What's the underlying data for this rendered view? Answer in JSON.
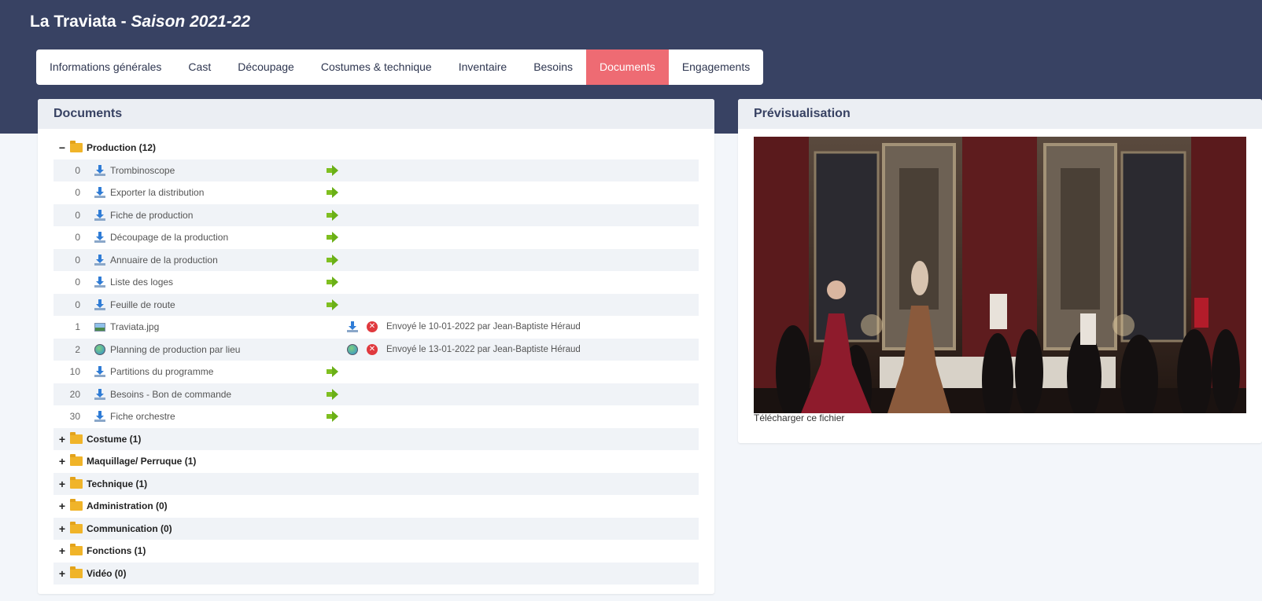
{
  "header": {
    "title": "La Traviata",
    "separator": " - ",
    "season": "Saison 2021-22"
  },
  "tabs": [
    {
      "label": "Informations générales",
      "active": false
    },
    {
      "label": "Cast",
      "active": false
    },
    {
      "label": "Découpage",
      "active": false
    },
    {
      "label": "Costumes & technique",
      "active": false
    },
    {
      "label": "Inventaire",
      "active": false
    },
    {
      "label": "Besoins",
      "active": false
    },
    {
      "label": "Documents",
      "active": true
    },
    {
      "label": "Engagements",
      "active": false
    }
  ],
  "documents_panel": {
    "title": "Documents",
    "production_folder": {
      "label": "Production (12)",
      "toggle": "−",
      "items": [
        {
          "num": "0",
          "label": "Trombinoscope",
          "icon": "download-icon",
          "action": "arrow"
        },
        {
          "num": "0",
          "label": "Exporter la distribution",
          "icon": "download-icon",
          "action": "arrow"
        },
        {
          "num": "0",
          "label": "Fiche de production",
          "icon": "download-icon",
          "action": "arrow"
        },
        {
          "num": "0",
          "label": "Découpage de la production",
          "icon": "download-icon",
          "action": "arrow"
        },
        {
          "num": "0",
          "label": "Annuaire de la production",
          "icon": "download-icon",
          "action": "arrow"
        },
        {
          "num": "0",
          "label": "Liste des loges",
          "icon": "download-icon",
          "action": "arrow"
        },
        {
          "num": "0",
          "label": "Feuille de route",
          "icon": "download-icon",
          "action": "arrow"
        },
        {
          "num": "1",
          "label": "Traviata.jpg",
          "icon": "image-file-icon",
          "action": "file",
          "sent": "Envoyé le 10-01-2022 par Jean-Baptiste Héraud"
        },
        {
          "num": "2",
          "label": "Planning de production par lieu",
          "icon": "globe-link-icon",
          "action": "file",
          "sent": "Envoyé le 13-01-2022 par Jean-Baptiste Héraud"
        },
        {
          "num": "10",
          "label": "Partitions du programme",
          "icon": "download-icon",
          "action": "arrow"
        },
        {
          "num": "20",
          "label": "Besoins - Bon de commande",
          "icon": "download-icon",
          "action": "arrow"
        },
        {
          "num": "30",
          "label": "Fiche orchestre",
          "icon": "download-icon",
          "action": "arrow"
        }
      ]
    },
    "folders": [
      {
        "label": "Costume (1)",
        "toggle": "+"
      },
      {
        "label": "Maquillage/ Perruque (1)",
        "toggle": "+"
      },
      {
        "label": "Technique (1)",
        "toggle": "+"
      },
      {
        "label": "Administration (0)",
        "toggle": "+"
      },
      {
        "label": "Communication (0)",
        "toggle": "+"
      },
      {
        "label": "Fonctions (1)",
        "toggle": "+"
      },
      {
        "label": "Vidéo (0)",
        "toggle": "+"
      }
    ],
    "delete_glyph": "✕"
  },
  "preview_panel": {
    "title": "Prévisualisation",
    "download_label": "Télécharger ce fichier"
  },
  "colors": {
    "header_bg": "#384263",
    "active_tab": "#ee6b73",
    "folder": "#f0b429",
    "arrow": "#6ab017",
    "delete": "#e0393e"
  }
}
